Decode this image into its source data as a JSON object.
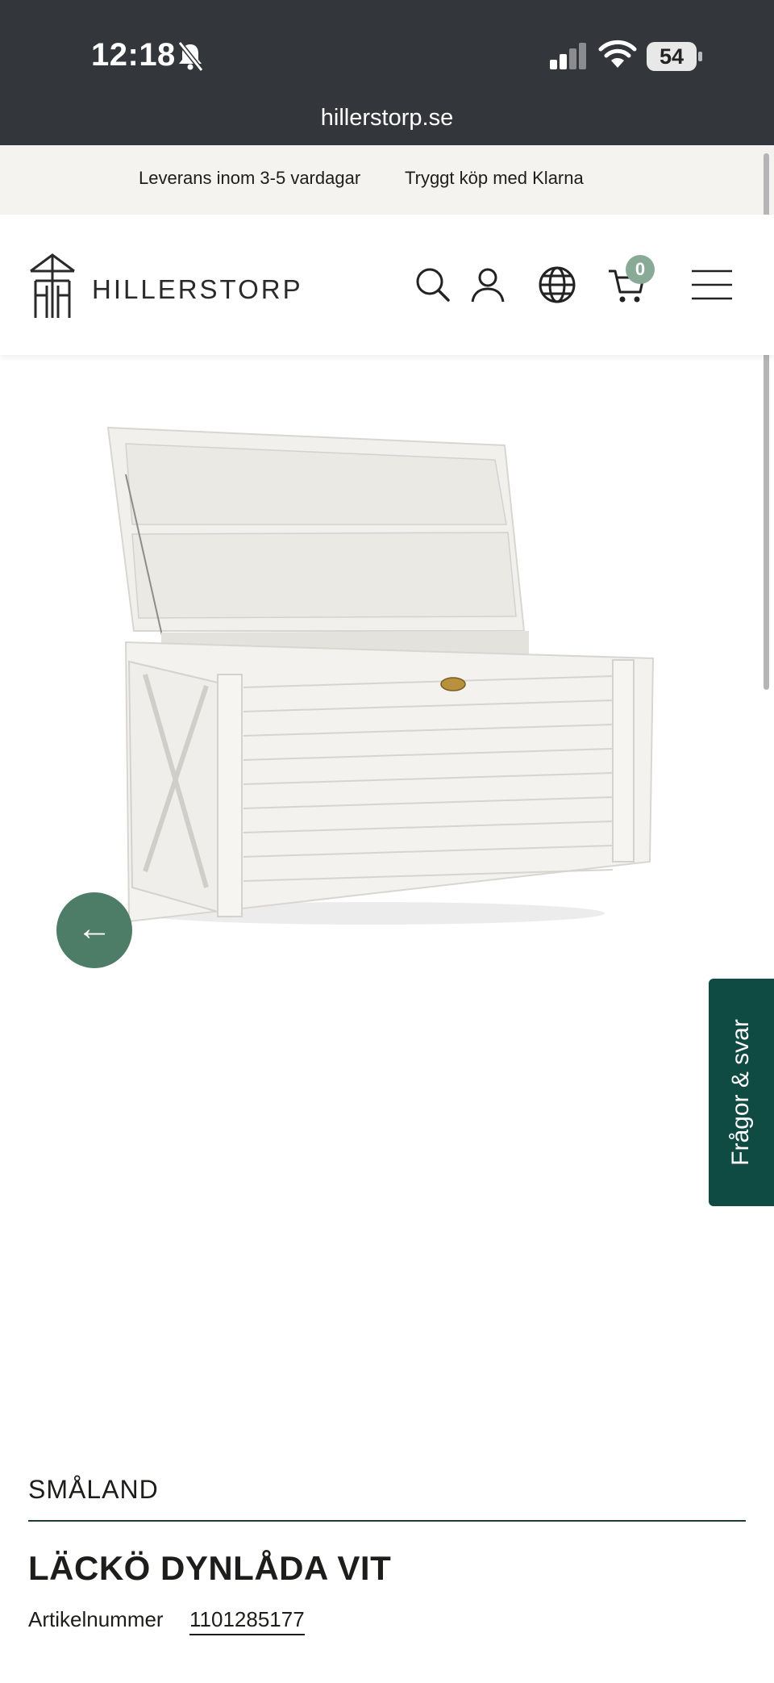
{
  "status_bar": {
    "time": "12:18",
    "battery": "54",
    "url": "hillerstorp.se"
  },
  "promo": {
    "items": [
      "Leverans inom 3-5 vardagar",
      "Tryggt köp med Klarna"
    ]
  },
  "header": {
    "brand": "HILLERSTORP",
    "cart_count": "0",
    "icons": [
      "search-icon",
      "account-icon",
      "globe-icon",
      "cart-icon",
      "menu-icon"
    ]
  },
  "product": {
    "brand": "SMÅLAND",
    "title": "LÄCKÖ DYNLÅDA VIT",
    "sku_label": "Artikelnummer",
    "sku_value": "1101285177"
  },
  "gallery": {
    "prev_label": "←"
  },
  "faq_tab": {
    "label": "Frågor & svar"
  },
  "colors": {
    "status_bar": "#33363a",
    "promo_bg": "#f4f3ef",
    "accent_green": "#4d7d67",
    "faq_tab": "#0f4a43",
    "cart_badge": "#8aaa98"
  }
}
